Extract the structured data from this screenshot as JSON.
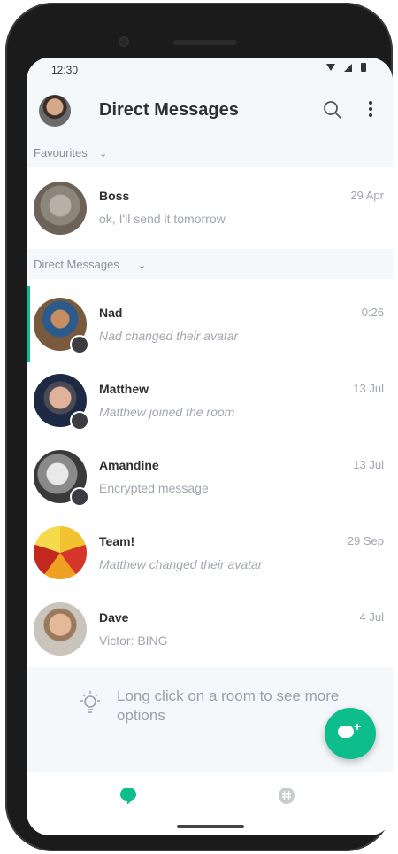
{
  "status_bar": {
    "time": "12:30"
  },
  "header": {
    "title": "Direct Messages"
  },
  "sections": {
    "favourites": {
      "label": "Favourites"
    },
    "direct_messages": {
      "label": "Direct Messages"
    }
  },
  "favourites": [
    {
      "name": "Boss",
      "last_message": "ok, I'll send it tomorrow",
      "time": "29 Apr"
    }
  ],
  "rooms": [
    {
      "name": "Nad",
      "last_message": "Nad changed their avatar",
      "time": "0:26"
    },
    {
      "name": "Matthew",
      "last_message": "Matthew joined the room",
      "time": "13 Jul"
    },
    {
      "name": "Amandine",
      "last_message": "Encrypted message",
      "time": "13 Jul"
    },
    {
      "name": "Team!",
      "last_message": "Matthew changed their avatar",
      "time": "29 Sep"
    },
    {
      "name": "Dave",
      "last_message": "Victor: BING",
      "time": "4 Jul"
    }
  ],
  "hint": {
    "text": "Long click on a room to see more options"
  },
  "icons": {
    "search": "search-icon",
    "more": "more-vertical-icon",
    "fab": "new-chat-icon",
    "bulb": "lightbulb-icon",
    "tab_dm": "chat-bubble-icon",
    "tab_rooms": "hash-icon"
  },
  "colors": {
    "accent": "#0dbd8b",
    "panel": "#f4f8fb",
    "text": "#2e2f32",
    "muted": "#a1a6ad"
  }
}
